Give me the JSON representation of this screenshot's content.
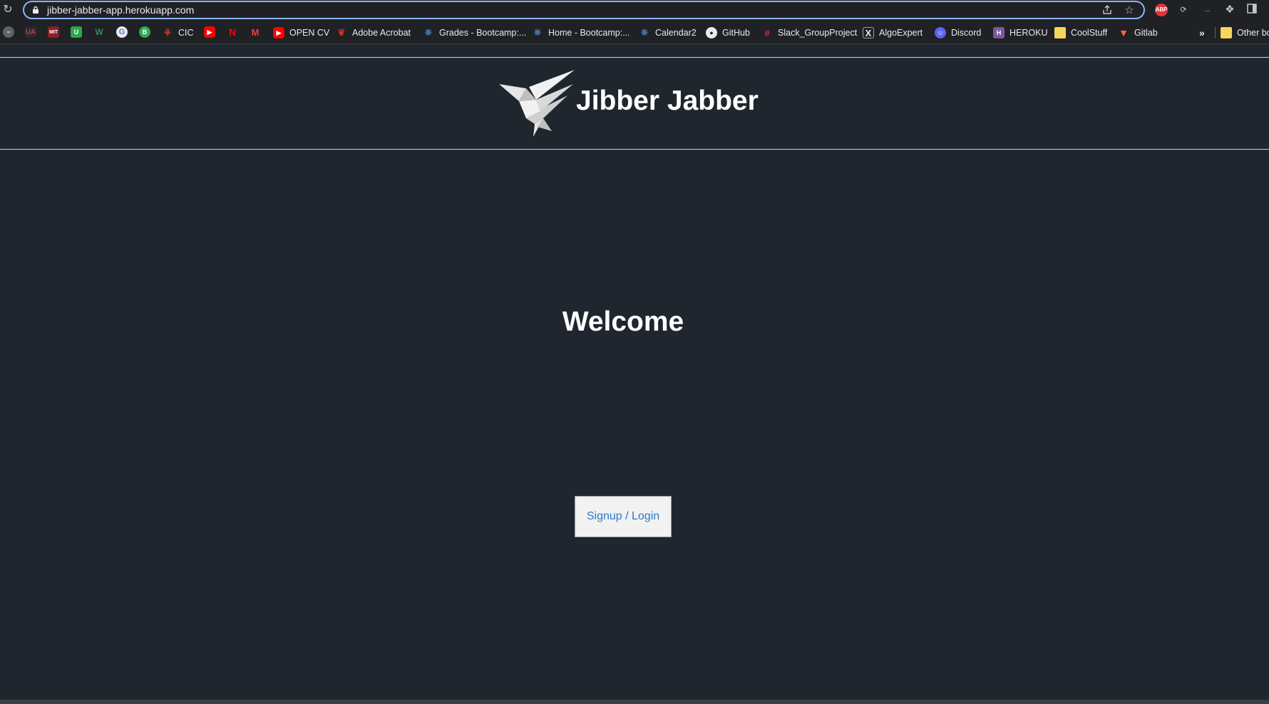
{
  "browser": {
    "url": "jibber-jabber-app.herokuapp.com",
    "icons": {
      "reload": "reload-icon",
      "lock": "lock-icon",
      "share": "share-icon",
      "bookmark_star": "star-icon",
      "extensions": [
        "adblock-icon",
        "extension-refresh-icon",
        "extension-translate-icon",
        "puzzle-icon",
        "side-panel-icon"
      ]
    },
    "adblock_label": "ABP"
  },
  "bookmarks": {
    "icon_only": [
      {
        "icon": "minus-circle-icon",
        "color": "#5f6368"
      },
      {
        "icon": "ua-logo-icon",
        "text": "UA",
        "color": "#7a1f2b"
      },
      {
        "icon": "mit-ocw-icon",
        "text": "MIT",
        "color": "#8a1f2b"
      },
      {
        "icon": "udacity-icon",
        "text": "U",
        "color": "#2ea44f"
      },
      {
        "icon": "w-logo-icon",
        "text": "W",
        "color": "#1e6b3a"
      },
      {
        "icon": "google-icon",
        "text": "G",
        "color": "#e8eaed"
      },
      {
        "icon": "b-circle-icon",
        "text": "B",
        "color": "#34a853"
      }
    ],
    "labeled": [
      {
        "label": "CIC",
        "icon": "maple-leaf-icon",
        "color": "#d93025"
      },
      {
        "label": "OPEN CV",
        "icon": "youtube-icon",
        "color": "#ff0000"
      },
      {
        "label": "Adobe Acrobat",
        "icon": "acrobat-icon",
        "color": "#d93025"
      },
      {
        "label": "Grades - Bootcamp:...",
        "icon": "bootcamp-icon",
        "color": "#4a6fa5"
      },
      {
        "label": "Home - Bootcamp:...",
        "icon": "bootcamp-icon",
        "color": "#4a6fa5"
      },
      {
        "label": "Calendar2",
        "icon": "bootcamp-icon",
        "color": "#4a6fa5"
      },
      {
        "label": "GitHub",
        "icon": "github-icon",
        "color": "#e8eaed"
      },
      {
        "label": "Slack_GroupProject",
        "icon": "slack-icon",
        "color": "#e01e5a"
      },
      {
        "label": "AlgoExpert",
        "icon": "algoexpert-icon",
        "color": "#1a73e8"
      },
      {
        "label": "Discord",
        "icon": "discord-icon",
        "color": "#5865f2"
      },
      {
        "label": "HEROKU",
        "icon": "heroku-icon",
        "color": "#79589f"
      },
      {
        "label": "CoolStuff",
        "icon": "folder-icon",
        "color": "#f6d55c"
      },
      {
        "label": "Gitlab",
        "icon": "gitlab-icon",
        "color": "#fc6d26"
      }
    ],
    "more": "»",
    "other": "Other bo"
  },
  "app": {
    "brand": "Jibber Jabber",
    "logo_icon": "bird-logo-icon",
    "welcome": "Welcome",
    "cta_label": "Signup / Login"
  }
}
